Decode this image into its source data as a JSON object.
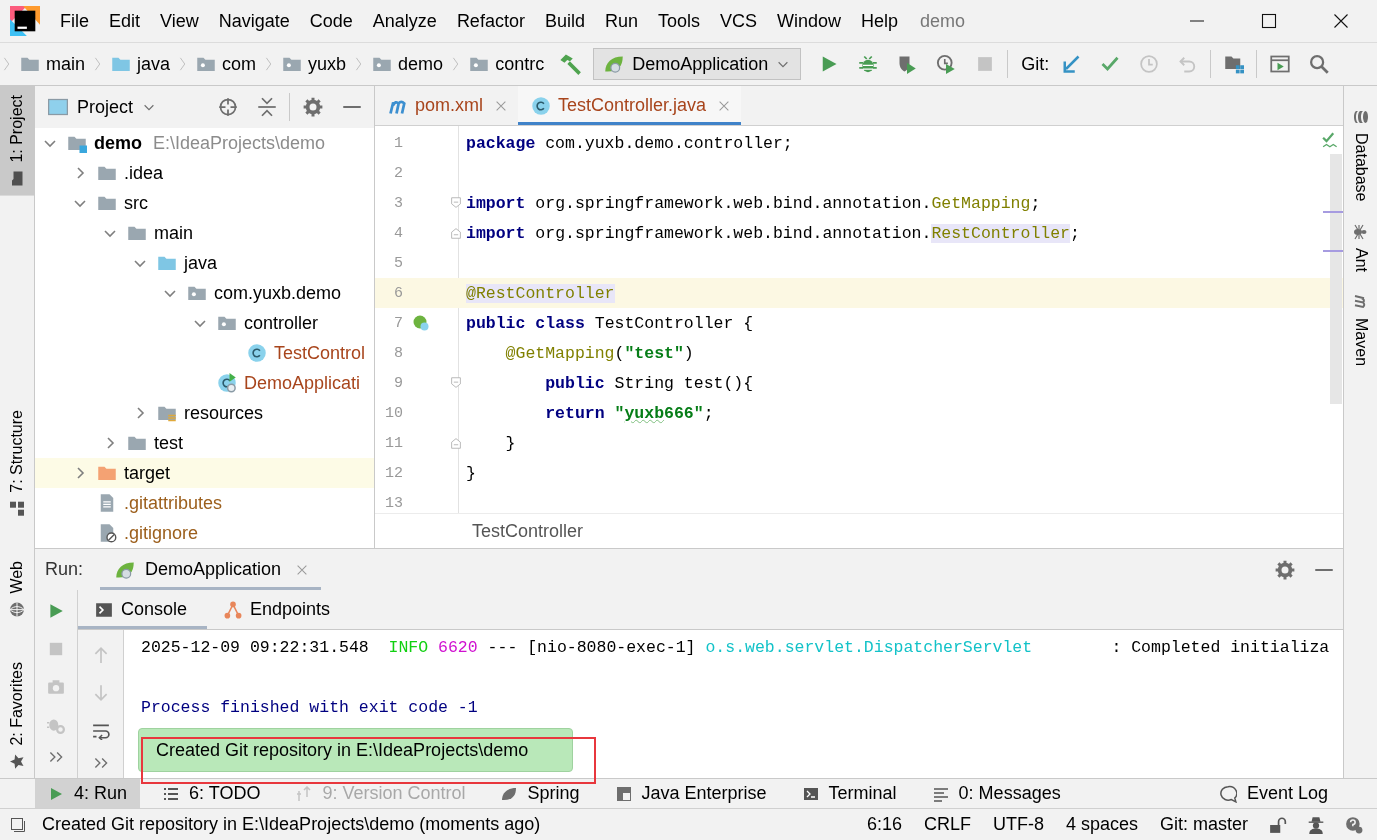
{
  "window": {
    "title": "demo"
  },
  "menu": [
    "File",
    "Edit",
    "View",
    "Navigate",
    "Code",
    "Analyze",
    "Refactor",
    "Build",
    "Run",
    "Tools",
    "VCS",
    "Window",
    "Help"
  ],
  "breadcrumbs": [
    {
      "label": "main",
      "kind": "folder"
    },
    {
      "label": "java",
      "kind": "source"
    },
    {
      "label": "com",
      "kind": "package"
    },
    {
      "label": "yuxb",
      "kind": "package"
    },
    {
      "label": "demo",
      "kind": "package"
    },
    {
      "label": "contrc",
      "kind": "package"
    }
  ],
  "run_config": {
    "label": "DemoApplication"
  },
  "run_actions": [
    {
      "kind": "run",
      "disabled": false
    },
    {
      "kind": "debug",
      "disabled": false
    },
    {
      "kind": "coverage",
      "disabled": false
    },
    {
      "kind": "profile",
      "disabled": false
    },
    {
      "kind": "stop",
      "disabled": true
    }
  ],
  "git_label": "Git:",
  "git_actions": [
    {
      "kind": "update",
      "disabled": false
    },
    {
      "kind": "commit",
      "disabled": false
    },
    {
      "kind": "history",
      "disabled": true
    },
    {
      "kind": "rollback",
      "disabled": true
    }
  ],
  "left_stripe": {
    "top": [
      {
        "label": "1: Project",
        "kind": "project",
        "selected": true
      },
      {
        "label": "7: Structure",
        "kind": "structure",
        "selected": false
      }
    ],
    "bottom": [
      {
        "label": "Web",
        "kind": "web",
        "selected": false
      },
      {
        "label": "2: Favorites",
        "kind": "favorites",
        "selected": false
      }
    ]
  },
  "project_panel": {
    "title": "Project",
    "tree": [
      {
        "label": "demo",
        "hint": "E:\\IdeaProjects\\demo",
        "kind": "module",
        "expanded": true,
        "highlighted": false,
        "color": "#000000",
        "children": [
          {
            "label": ".idea",
            "kind": "folder",
            "expanded": false,
            "highlighted": false,
            "color": "#000000"
          },
          {
            "label": "src",
            "kind": "folder",
            "expanded": true,
            "highlighted": false,
            "color": "#000000",
            "children": [
              {
                "label": "main",
                "kind": "folder",
                "expanded": true,
                "highlighted": false,
                "color": "#000000",
                "children": [
                  {
                    "label": "java",
                    "kind": "source",
                    "expanded": true,
                    "highlighted": false,
                    "color": "#000000",
                    "children": [
                      {
                        "label": "com.yuxb.demo",
                        "kind": "package",
                        "expanded": true,
                        "highlighted": false,
                        "color": "#000000",
                        "children": [
                          {
                            "label": "controller",
                            "kind": "package",
                            "expanded": true,
                            "highlighted": false,
                            "color": "#000000",
                            "children": [
                              {
                                "label": "TestControl",
                                "kind": "class",
                                "highlighted": false,
                                "color": "#a8451c"
                              }
                            ]
                          },
                          {
                            "label": "DemoApplicati",
                            "kind": "app",
                            "highlighted": false,
                            "color": "#a8451c"
                          }
                        ]
                      }
                    ]
                  },
                  {
                    "label": "resources",
                    "kind": "resources",
                    "expanded": false,
                    "highlighted": false,
                    "color": "#000000"
                  }
                ]
              },
              {
                "label": "test",
                "kind": "folder",
                "expanded": false,
                "highlighted": false,
                "color": "#000000"
              }
            ]
          },
          {
            "label": "target",
            "kind": "excluded",
            "expanded": false,
            "highlighted": true,
            "color": "#000000"
          },
          {
            "label": ".gitattributes",
            "kind": "file",
            "highlighted": false,
            "color": "#9c5f1c"
          },
          {
            "label": ".gitignore",
            "kind": "ignore",
            "highlighted": false,
            "color": "#9c5f1c"
          }
        ]
      }
    ]
  },
  "editor": {
    "tabs": [
      {
        "label": "pom.xml",
        "kind": "maven",
        "selected": false
      },
      {
        "label": "TestController.java",
        "kind": "class",
        "selected": true
      }
    ],
    "lines": [
      {
        "number": "1",
        "current": false,
        "kind": "plain",
        "tokens": [
          {
            "text": "package",
            "kind": "keyword"
          },
          {
            "text": " com.yuxb.demo.controller;",
            "kind": "plain"
          }
        ]
      },
      {
        "number": "2",
        "current": false,
        "kind": "plain"
      },
      {
        "number": "3",
        "current": false,
        "kind": "fold-open",
        "tokens": [
          {
            "text": "import",
            "kind": "keyword"
          },
          {
            "text": " org.springframework.web.bind.annotation.",
            "kind": "plain"
          },
          {
            "text": "GetMapping",
            "kind": "annotation"
          },
          {
            "text": ";",
            "kind": "plain"
          }
        ]
      },
      {
        "number": "4",
        "current": false,
        "kind": "fold-close",
        "tokens": [
          {
            "text": "import",
            "kind": "keyword"
          },
          {
            "text": " org.springframework.web.bind.annotation.",
            "kind": "plain"
          },
          {
            "text": "RestController",
            "kind": "annotation-usage"
          },
          {
            "text": ";",
            "kind": "plain"
          }
        ]
      },
      {
        "number": "5",
        "current": false,
        "kind": "plain"
      },
      {
        "number": "6",
        "current": true,
        "kind": "plain",
        "tokens": [
          {
            "text": "@RestController",
            "kind": "annotation-usage"
          }
        ]
      },
      {
        "number": "7",
        "current": false,
        "kind": "bean",
        "tokens": [
          {
            "text": "public",
            "kind": "keyword"
          },
          {
            "text": " class",
            "kind": "keyword"
          },
          {
            "text": " TestController {",
            "kind": "plain"
          }
        ]
      },
      {
        "number": "8",
        "current": false,
        "kind": "plain",
        "tokens": [
          {
            "text": "    @GetMapping",
            "kind": "annotation"
          },
          {
            "text": "(",
            "kind": "plain"
          },
          {
            "text": "\"test\"",
            "kind": "string"
          },
          {
            "text": ")",
            "kind": "plain"
          }
        ]
      },
      {
        "number": "9",
        "current": false,
        "kind": "fold-open",
        "tokens": [
          {
            "text": "        public",
            "kind": "keyword"
          },
          {
            "text": " String test(){",
            "kind": "plain"
          }
        ]
      },
      {
        "number": "10",
        "current": false,
        "kind": "plain",
        "tokens": [
          {
            "text": "        return",
            "kind": "keyword"
          },
          {
            "text": " \"",
            "kind": "string"
          },
          {
            "text": "yuxb",
            "kind": "string-typo"
          },
          {
            "text": "666\"",
            "kind": "string"
          },
          {
            "text": ";",
            "kind": "plain"
          }
        ]
      },
      {
        "number": "11",
        "current": false,
        "kind": "fold-close",
        "tokens": [
          {
            "text": "    }",
            "kind": "plain"
          }
        ]
      },
      {
        "number": "12",
        "current": false,
        "kind": "plain",
        "tokens": [
          {
            "text": "}",
            "kind": "plain"
          }
        ]
      },
      {
        "number": "13",
        "current": false,
        "kind": "plain"
      }
    ],
    "breadcrumb": "TestController"
  },
  "right_stripe": [
    {
      "label": "Database",
      "kind": "database",
      "selected": false
    },
    {
      "label": "Ant",
      "kind": "ant",
      "selected": false
    },
    {
      "label": "Maven",
      "kind": "maven",
      "selected": false
    }
  ],
  "run_panel": {
    "title": "Run:",
    "tab": "DemoApplication",
    "subtabs": [
      {
        "label": "Console",
        "kind": "console",
        "selected": true
      },
      {
        "label": "Endpoints",
        "kind": "endpoints",
        "selected": false
      }
    ],
    "side_actions": [
      {
        "kind": "rerun",
        "disabled": false
      },
      {
        "kind": "stop",
        "disabled": true
      },
      {
        "kind": "camera",
        "disabled": true
      },
      {
        "kind": "bug-settings",
        "disabled": true
      },
      {
        "kind": "more",
        "disabled": false
      }
    ],
    "console_actions": [
      {
        "kind": "up",
        "disabled": true
      },
      {
        "kind": "down",
        "disabled": true
      },
      {
        "kind": "wrap",
        "disabled": false
      },
      {
        "kind": "more",
        "disabled": false
      }
    ],
    "console": [
      {
        "kind": "log",
        "tokens": [
          {
            "text": "2025-12-09 09:22:31.548  ",
            "kind": "plain"
          },
          {
            "text": "INFO ",
            "kind": "info"
          },
          {
            "text": "6620",
            "kind": "pid"
          },
          {
            "text": " --- [nio-8080-exec-1] ",
            "kind": "plain"
          },
          {
            "text": "o.s.web.servlet.DispatcherServlet",
            "kind": "logger"
          },
          {
            "text": "        : Completed initializa",
            "kind": "plain"
          }
        ]
      },
      {
        "kind": "exit",
        "tokens": [
          {
            "text": "Process finished with exit code -1",
            "kind": "plain"
          }
        ]
      }
    ]
  },
  "balloon": {
    "text": "Created Git repository in E:\\IdeaProjects\\demo",
    "outlined": true
  },
  "tool_windows": [
    {
      "label": "4: Run",
      "kind": "run",
      "selected": true,
      "disabled": false
    },
    {
      "label": "6: TODO",
      "kind": "todo",
      "selected": false,
      "disabled": false
    },
    {
      "label": "9: Version Control",
      "kind": "vcs",
      "selected": false,
      "disabled": true
    },
    {
      "label": "Spring",
      "kind": "spring",
      "selected": false,
      "disabled": false
    },
    {
      "label": "Java Enterprise",
      "kind": "javaee",
      "selected": false,
      "disabled": false
    },
    {
      "label": "Terminal",
      "kind": "terminal",
      "selected": false,
      "disabled": false
    },
    {
      "label": "0: Messages",
      "kind": "messages",
      "selected": false,
      "disabled": false
    }
  ],
  "event_log": {
    "label": "Event Log"
  },
  "status_bar": {
    "message": "Created Git repository in E:\\IdeaProjects\\demo (moments ago)",
    "items": [
      "6:16",
      "CRLF",
      "UTF-8",
      "4 spaces",
      "Git: master"
    ]
  }
}
